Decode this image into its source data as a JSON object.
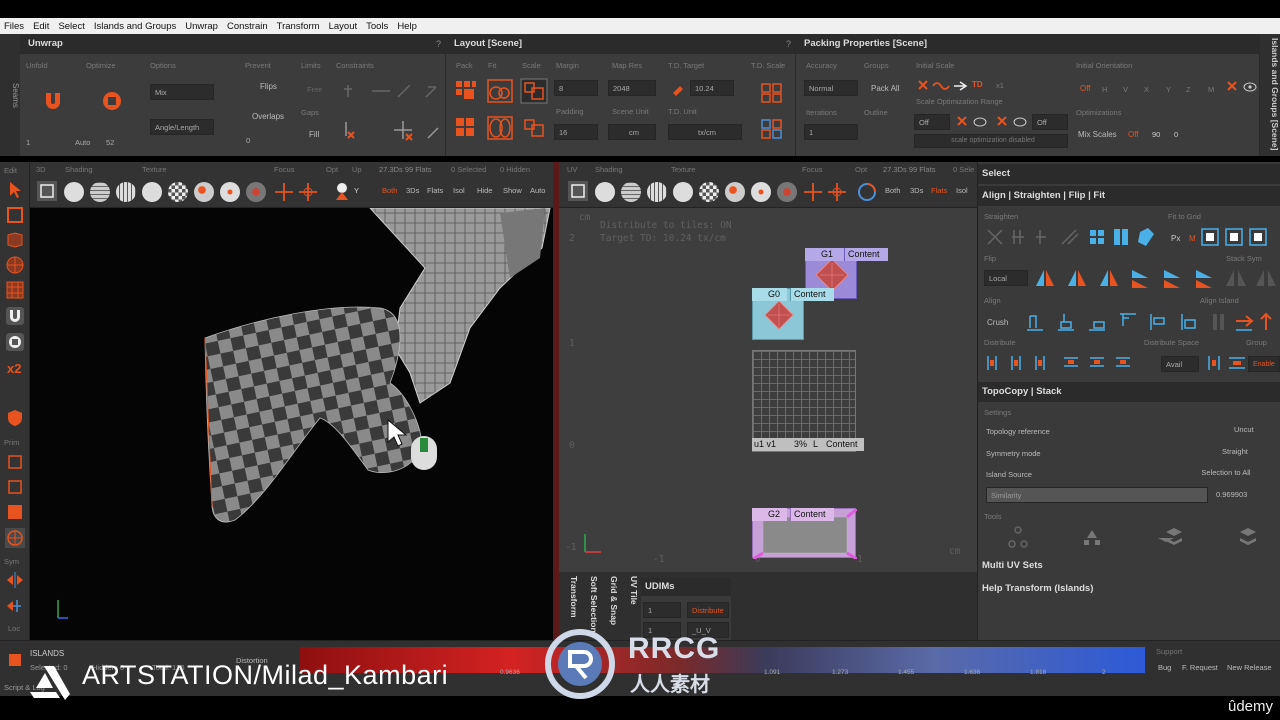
{
  "menu": [
    "Files",
    "Edit",
    "Select",
    "Islands and Groups",
    "Unwrap",
    "Constrain",
    "Transform",
    "Layout",
    "Tools",
    "Help"
  ],
  "left_strip_label": "Seams",
  "right_strip_label": "Islands and Groups [Scene]",
  "unwrap": {
    "title": "Unwrap",
    "sections": [
      "Unfold",
      "Optimize",
      "Options",
      "Prevent",
      "Limits",
      "Constraints"
    ],
    "mix_label": "Mix",
    "angle_length_label": "Angle/Length",
    "flips_label": "Flips",
    "overlaps_label": "Overlaps",
    "free_label": "Free",
    "gaps_label": "Gaps",
    "fill_label": "Fill",
    "count_value": "1",
    "auto_label": "Auto",
    "auto_value": "52",
    "gaps_value": "0"
  },
  "layout": {
    "title": "Layout [Scene]",
    "sections": [
      "Pack",
      "Fit",
      "Scale",
      "Margin",
      "Map Res",
      "T.D. Target",
      "T.D. Scale"
    ],
    "margin_value": "8",
    "map_res_value": "2048",
    "td_target_value": "10.24",
    "padding_label": "Padding",
    "padding_value": "16",
    "scene_unit_label": "Scene Unit",
    "scene_unit_value": "cm",
    "td_unit_label": "T.D. Unit",
    "td_unit_value": "tx/cm"
  },
  "packing": {
    "title": "Packing Properties [Scene]",
    "accuracy_label": "Accuracy",
    "accuracy_value": "Normal",
    "groups_label": "Groups",
    "pack_all_label": "Pack All",
    "initial_scale_label": "Initial Scale",
    "initial_orientation_label": "Initial Orientation",
    "td_label": "TD",
    "x1_label": "x1",
    "off_label": "Off",
    "axes": [
      "H",
      "V",
      "X",
      "Y",
      "Z",
      "M"
    ],
    "iterations_label": "Iterations",
    "iterations_value": "1",
    "outline_label": "Outline",
    "sor_label": "Scale Optimization Range",
    "sor_value_a": "Off",
    "sor_value_b": "Off",
    "optimizations_label": "Optimizations",
    "mix_scales_label": "Mix Scales",
    "mix_off": "Off",
    "mix_value_a": "90",
    "mix_value_b": "0",
    "disabled_msg": "scale optimization disabled"
  },
  "view3d": {
    "header_labels": [
      "3D",
      "Shading",
      "Texture",
      "Focus",
      "Opt",
      "Up"
    ],
    "stats": "27.3Ds 99 Flats",
    "selected": "0 Selected",
    "hidden": "0 Hidden",
    "up_value": "Y",
    "buttons": [
      "Both",
      "3Ds",
      "Flats",
      "Isol",
      "Hide",
      "Show",
      "Auto"
    ]
  },
  "viewuv": {
    "header_labels": [
      "UV",
      "Shading",
      "Texture",
      "Focus",
      "Opt"
    ],
    "stats": "27.3Ds 99 Flats",
    "selected": "0 Sele",
    "buttons": [
      "Both",
      "3Ds",
      "Flats",
      "Isol"
    ],
    "cm_label": "cm",
    "info_line1": "Distribute to tiles: ON",
    "info_line2": "Target TD: 10.24 tx/cm",
    "ticks_y": [
      "2",
      "1",
      "0",
      "-1"
    ],
    "ticks_x": [
      "-1",
      "0",
      "1"
    ],
    "tiles": [
      {
        "name": "G1",
        "content": "Content"
      },
      {
        "name": "G0",
        "content": "Content"
      },
      {
        "name": "u1 v1",
        "pct": "3%",
        "l": "L",
        "content": "Content"
      },
      {
        "name": "G2",
        "content": "Content"
      }
    ]
  },
  "uv_dock": {
    "tabs": [
      "Transform",
      "Soft Selection",
      "Grid & Snap",
      "UV Tile"
    ],
    "udims_title": "UDIMs",
    "udim_value_a": "1",
    "udim_value_b": "1",
    "distribute_label": "Distribute",
    "uv_pattern": "_U_V"
  },
  "right_panel": {
    "select_title": "Select",
    "align_title": "Align | Straighten | Flip | Fit",
    "straighten_label": "Straighten",
    "fit_to_grid_label": "Fit to Grid",
    "px_label": "Px",
    "m_label": "M",
    "flip_label": "Flip",
    "stack_sym_label": "Stack Sym",
    "local_label": "Local",
    "align_label": "Align",
    "align_island_label": "Align Island",
    "crush_label": "Crush",
    "distribute_label": "Distribute",
    "distribute_space_label": "Distribute Space",
    "group_label": "Group",
    "avail_label": "Avail",
    "enable_label": "Enable",
    "topocopy_title": "TopoCopy | Stack",
    "settings_label": "Settings",
    "topology_reference_label": "Topology reference",
    "topology_reference_value": "Uncut",
    "symmetry_mode_label": "Symmetry mode",
    "symmetry_mode_value": "Straight",
    "island_source_label": "Island Source",
    "island_source_value": "Selection to All",
    "similarity_label": "Similarity",
    "similarity_value": "0.969903",
    "tools_label": "Tools",
    "multi_uv_title": "Multi UV Sets",
    "help_title": "Help Transform (Islands)"
  },
  "tool_labels": {
    "edit": "Edit",
    "prim": "Prim",
    "sym": "Sym",
    "loc": "Loc"
  },
  "bottom": {
    "islands_label": "ISLANDS",
    "selected": "Selected: 0",
    "hidden": "Hidden: 0",
    "total": "Total: 126",
    "distortion_label": "Distortion",
    "scale_values": [
      "0.9636",
      "1.091",
      "1.273",
      "1.455",
      "1.636",
      "1.818",
      "2"
    ],
    "support_label": "Support",
    "bug_label": "Bug",
    "feature_request_label": "F. Request",
    "new_release_label": "New Release",
    "script_log_label": "Script & Log"
  },
  "watermark_artstation": "ARTSTATION/Milad_Kambari",
  "watermark_rrcg_top": "RRCG",
  "watermark_rrcg_bottom": "人人素材",
  "udemy_label": "ûdemy"
}
